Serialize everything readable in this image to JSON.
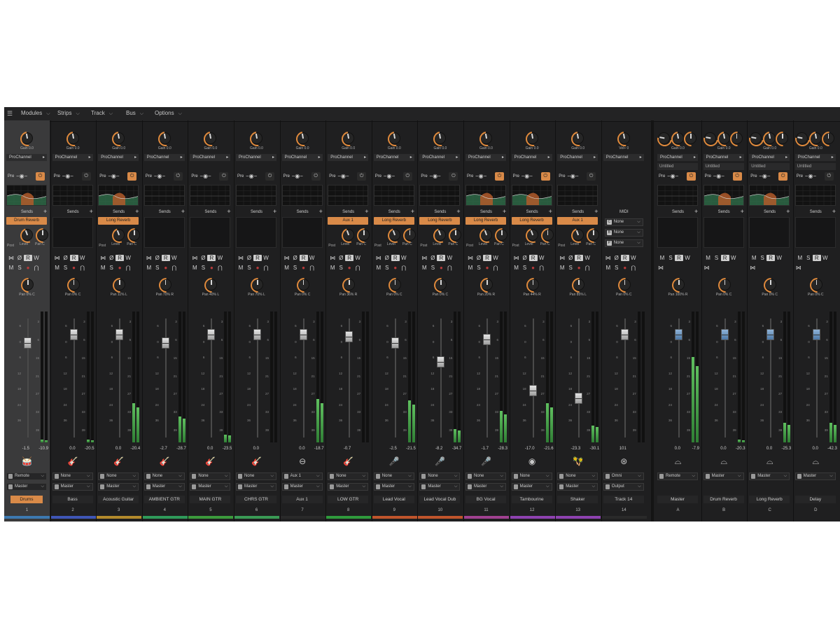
{
  "menubar": {
    "items": [
      {
        "label": "Modules"
      },
      {
        "label": "Strips"
      },
      {
        "label": "Track"
      },
      {
        "label": "Bus"
      },
      {
        "label": "Options"
      }
    ]
  },
  "labels": {
    "prochannel": "ProChannel",
    "pre": "Pre",
    "sends": "Sends",
    "post": "Post",
    "level": "Level",
    "pan_c": "Pan C",
    "midi": "MIDI",
    "untitled": "Untitled",
    "remote": "Remote",
    "master": "Master",
    "none": "None",
    "omni": "Omni",
    "output": "Output"
  },
  "tracks": [
    {
      "number": "1",
      "name": "Drums",
      "gain": "Gain 0.0",
      "send": "Drum Reverb",
      "pan": "Pan 0% C",
      "peak_l": "-1.5",
      "peak_r": "-10.9",
      "color": "#3d79b0",
      "input": "Remote",
      "output": "Master",
      "icon": "drums-icon",
      "glyph": "🥁",
      "eq": true,
      "power": true,
      "meter": 0.02,
      "fader": 0.08,
      "selected": true,
      "active": true
    },
    {
      "number": "2",
      "name": "Bass",
      "gain": "Gain 0.0",
      "send": "",
      "pan": "Pan 0% C",
      "peak_l": "0.0",
      "peak_r": "-20.5",
      "color": "#3f56b6",
      "input": "None",
      "output": "Master",
      "icon": "bass-guitar-icon",
      "glyph": "🎸",
      "eq": false,
      "power": false,
      "meter": 0.02,
      "fader": 0.0
    },
    {
      "number": "3",
      "name": "Acoustic Guitar",
      "gain": "Gain 0.0",
      "send": "Long Reverb",
      "pan": "Pan 11% L",
      "peak_l": "0.0",
      "peak_r": "-20.4",
      "color": "#b38a2c",
      "input": "None",
      "output": "Master",
      "icon": "acoustic-guitar-icon",
      "glyph": "🎸",
      "eq": true,
      "power": true,
      "meter": 0.3,
      "fader": 0.0
    },
    {
      "number": "4",
      "name": "AMBIENT GTR",
      "gain": "Gain 0.0",
      "send": "",
      "pan": "Pan 70% R",
      "peak_l": "-2.7",
      "peak_r": "-28.7",
      "color": "#2f9a5a",
      "input": "None",
      "output": "Master",
      "icon": "electric-guitar-icon",
      "glyph": "🎸",
      "eq": false,
      "power": false,
      "meter": 0.2,
      "fader": 0.08
    },
    {
      "number": "5",
      "name": "MAIN GTR",
      "gain": "Gain 0.0",
      "send": "",
      "pan": "Pan 40% L",
      "peak_l": "0.0",
      "peak_r": "-23.5",
      "color": "#3c9a3c",
      "input": "None",
      "output": "Master",
      "icon": "electric-guitar-icon",
      "glyph": "🎸",
      "eq": false,
      "power": false,
      "meter": 0.06,
      "fader": 0.0
    },
    {
      "number": "6",
      "name": "CHRS GTR",
      "gain": "Gain 0.0",
      "send": "",
      "pan": "Pan 70% L",
      "peak_l": "0.0",
      "peak_r": "",
      "color": "#3a9a55",
      "input": "None",
      "output": "Master",
      "icon": "electric-guitar-icon",
      "glyph": "🎸",
      "eq": false,
      "power": false,
      "meter": 0.0,
      "fader": 0.0
    },
    {
      "number": "7",
      "name": "Aux 1",
      "gain": "Gain 0.0",
      "send": "",
      "pan": "Pan 0% C",
      "peak_l": "0.0",
      "peak_r": "-18.7",
      "color": "#2a2a2a",
      "input": "Aux 1",
      "output": "Master",
      "icon": "aux-input-icon",
      "glyph": "⊖",
      "eq": false,
      "power": false,
      "meter": 0.33,
      "fader": 0.0
    },
    {
      "number": "8",
      "name": "LOW GTR",
      "gain": "Gain 0.0",
      "send": "Aux 1",
      "pan": "Pan 36% R",
      "peak_l": "-0.7",
      "peak_r": "",
      "color": "#2f9a3c",
      "input": "None",
      "output": "Master",
      "icon": "electric-guitar-icon",
      "glyph": "🎸",
      "eq": false,
      "power": false,
      "meter": 0.0,
      "fader": 0.02
    },
    {
      "number": "9",
      "name": "Lead Vocal",
      "gain": "Gain 0.0",
      "send": "Long Reverb",
      "pan": "Pan 0% C",
      "peak_l": "-2.5",
      "peak_r": "-21.5",
      "color": "#c0552c",
      "input": "None",
      "output": "Master",
      "icon": "microphone-icon",
      "glyph": "🎤",
      "eq": false,
      "power": false,
      "meter": 0.32,
      "fader": 0.08
    },
    {
      "number": "10",
      "name": "Lead Vocal Dub",
      "gain": "Gain 0.0",
      "send": "Long Reverb",
      "pan": "Pan 0% C",
      "peak_l": "-8.2",
      "peak_r": "-34.7",
      "color": "#c0552c",
      "input": "None",
      "output": "Master",
      "icon": "microphone-icon",
      "glyph": "🎤",
      "eq": false,
      "power": false,
      "meter": 0.1,
      "fader": 0.27
    },
    {
      "number": "11",
      "name": "BG Vocal",
      "gain": "Gain 0.0",
      "send": "Long Reverb",
      "pan": "Pan 20% R",
      "peak_l": "-1.7",
      "peak_r": "-28.3",
      "color": "#a04190",
      "input": "None",
      "output": "Master",
      "icon": "microphone-icon",
      "glyph": "🎤",
      "eq": true,
      "power": true,
      "meter": 0.24,
      "fader": 0.05
    },
    {
      "number": "12",
      "name": "Tambourine",
      "gain": "Gain 0.0",
      "send": "Long Reverb",
      "pan": "Pan 44% R",
      "peak_l": "-17.0",
      "peak_r": "-21.6",
      "color": "#8e42b0",
      "input": "None",
      "output": "Master",
      "icon": "tambourine-icon",
      "glyph": "◉",
      "eq": true,
      "power": true,
      "meter": 0.3,
      "fader": 0.55
    },
    {
      "number": "13",
      "name": "Shaker",
      "gain": "Gain 0.0",
      "send": "Aux 1",
      "pan": "Pan 85% L",
      "peak_l": "-23.3",
      "peak_r": "-30.1",
      "color": "#8e42b0",
      "input": "None",
      "output": "Master",
      "icon": "shaker-icon",
      "glyph": "🪇",
      "eq": false,
      "power": false,
      "meter": 0.13,
      "fader": 0.63
    },
    {
      "number": "14",
      "name": "Track 14",
      "gain": "Vel+ 0",
      "send": "",
      "pan": "Pan 0% C",
      "peak_l": "101",
      "peak_r": "",
      "color": "#2a2a2a",
      "input": "Omni",
      "output": "Output",
      "icon": "midi-port-icon",
      "glyph": "⊛",
      "eq": false,
      "power": false,
      "meter": 0.0,
      "fader": 0.0,
      "midi": true
    }
  ],
  "buses": [
    {
      "letter": "A",
      "name": "Master",
      "gain": "Gain 0.0",
      "pan": "Pan 100% R",
      "peak_l": "0.0",
      "peak_r": "-7.9",
      "output": "Remote",
      "eq": false,
      "power": true,
      "meter": 0.65
    },
    {
      "letter": "B",
      "name": "Drum Reverb",
      "gain": "Gain 0.0",
      "pan": "Pan 0% C",
      "peak_l": "0.0",
      "peak_r": "-20.3",
      "output": "Master",
      "eq": true,
      "power": true,
      "meter": 0.02
    },
    {
      "letter": "C",
      "name": "Long Reverb",
      "gain": "Gain 0.0",
      "pan": "Pan 0% C",
      "peak_l": "0.0",
      "peak_r": "-25.3",
      "output": "Master",
      "eq": true,
      "power": true,
      "meter": 0.15
    },
    {
      "letter": "D",
      "name": "Delay",
      "gain": "Gain 0.0",
      "pan": "Pan 0% C",
      "peak_l": "0.0",
      "peak_r": "-42.3",
      "output": "Master",
      "eq": false,
      "power": false,
      "meter": 0.15
    }
  ],
  "midi_strip": {
    "dropdowns": [
      "None",
      "None",
      "None"
    ]
  },
  "colors": {
    "accent_orange": "#d98a48",
    "meter_green": "#4fb04f",
    "background": "#1f1f20"
  }
}
